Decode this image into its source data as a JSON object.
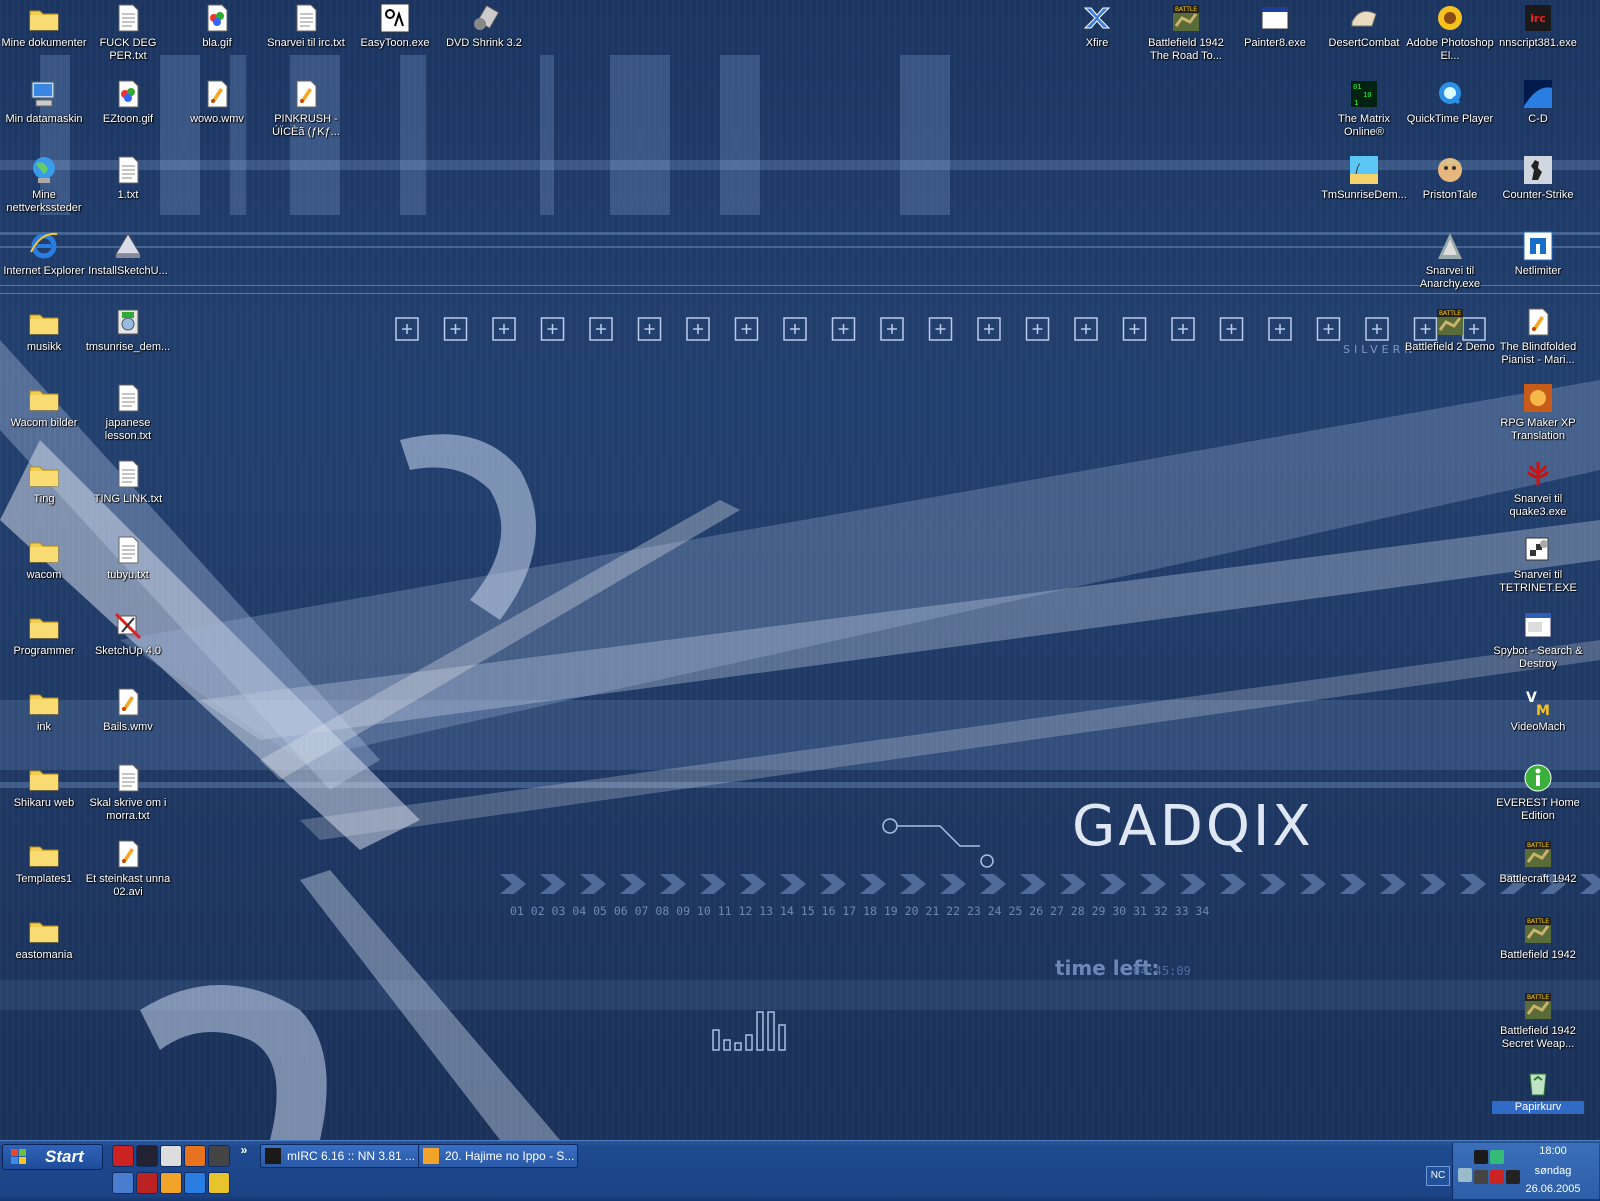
{
  "desktop": {
    "wallpaper": {
      "brand": "GADQIX",
      "timer_label": "time left:",
      "timer_value": "04:45:09",
      "number_row": "01 02 03 04 05 06 07 08 09 10 11 12 13 14 15 16 17 18 19 20 21 22 23 24 25 26 27 28 29 30 31 32 33 34",
      "small_text": "SILVERN",
      "colors": {
        "base": "#1f3a66",
        "accent": "#cfe0ff"
      }
    },
    "icons": [
      {
        "label": "Mine dokumenter",
        "icon": "folder-icon"
      },
      {
        "label": "FUCK DEG PER.txt",
        "icon": "text-file-icon"
      },
      {
        "label": "bla.gif",
        "icon": "image-file-icon"
      },
      {
        "label": "Snarvei til irc.txt",
        "icon": "text-file-icon"
      },
      {
        "label": "EasyToon.exe",
        "icon": "easytoon-icon"
      },
      {
        "label": "DVD Shrink 3.2",
        "icon": "dvd-shrink-icon"
      },
      {
        "label": "Xfire",
        "icon": "xfire-icon"
      },
      {
        "label": "Battlefield 1942 The Road To...",
        "icon": "battlefield-icon"
      },
      {
        "label": "Painter8.exe",
        "icon": "window-app-icon"
      },
      {
        "label": "DesertCombat",
        "icon": "desertcombat-icon"
      },
      {
        "label": "Adobe Photoshop El...",
        "icon": "photoshop-sunflower-icon"
      },
      {
        "label": "nnscript381.exe",
        "icon": "mirc-icon"
      },
      {
        "label": "Min datamaskin",
        "icon": "computer-icon"
      },
      {
        "label": "EZtoon.gif",
        "icon": "image-file-icon"
      },
      {
        "label": "wowo.wmv",
        "icon": "media-file-icon"
      },
      {
        "label": "PINKRUSH - ÚÏCÈã (ƒKƒ...",
        "icon": "media-file-icon"
      },
      {
        "label": "The Matrix Online®",
        "icon": "matrix-icon"
      },
      {
        "label": "QuickTime Player",
        "icon": "quicktime-icon"
      },
      {
        "label": "C-D",
        "icon": "cd-icon"
      },
      {
        "label": "Mine nettverkssteder",
        "icon": "network-globe-icon"
      },
      {
        "label": "1.txt",
        "icon": "text-file-icon"
      },
      {
        "label": "TmSunriseDem...",
        "icon": "tmsunrise-icon"
      },
      {
        "label": "PristonTale",
        "icon": "pristontale-icon"
      },
      {
        "label": "Counter-Strike",
        "icon": "counterstrike-icon"
      },
      {
        "label": "Internet Explorer",
        "icon": "ie-icon"
      },
      {
        "label": "InstallSketchU...",
        "icon": "installer-icon"
      },
      {
        "label": "Snarvei til Anarchy.exe",
        "icon": "anarchy-icon"
      },
      {
        "label": "Netlimiter",
        "icon": "netlimiter-icon"
      },
      {
        "label": "musikk",
        "icon": "folder-icon"
      },
      {
        "label": "tmsunrise_dem...",
        "icon": "installer-cd-icon"
      },
      {
        "label": "Battlefield 2 Demo",
        "icon": "battlefield-icon"
      },
      {
        "label": "The Blindfolded Pianist - Mari...",
        "icon": "media-file-icon"
      },
      {
        "label": "Wacom bilder",
        "icon": "folder-icon"
      },
      {
        "label": "japanese lesson.txt",
        "icon": "text-file-icon"
      },
      {
        "label": "RPG Maker XP Translation",
        "icon": "rpgmaker-icon"
      },
      {
        "label": "Ting",
        "icon": "folder-icon"
      },
      {
        "label": "TING LINK.txt",
        "icon": "text-file-icon"
      },
      {
        "label": "Snarvei til quake3.exe",
        "icon": "quake-icon"
      },
      {
        "label": "wacom",
        "icon": "folder-icon"
      },
      {
        "label": "tubyu.txt",
        "icon": "text-file-icon"
      },
      {
        "label": "Snarvei til TETRINET.EXE",
        "icon": "tetrinet-icon"
      },
      {
        "label": "Programmer",
        "icon": "folder-icon"
      },
      {
        "label": "SketchUp 4.0",
        "icon": "sketchup-icon"
      },
      {
        "label": "Spybot - Search & Destroy",
        "icon": "spybot-icon"
      },
      {
        "label": "ink",
        "icon": "folder-icon"
      },
      {
        "label": "Bails.wmv",
        "icon": "media-file-icon"
      },
      {
        "label": "VideoMach",
        "icon": "videomach-icon"
      },
      {
        "label": "Shikaru web",
        "icon": "folder-icon"
      },
      {
        "label": "Skal skrive om i morra.txt",
        "icon": "text-file-icon"
      },
      {
        "label": "EVEREST Home Edition",
        "icon": "everest-icon"
      },
      {
        "label": "Templates1",
        "icon": "folder-icon"
      },
      {
        "label": "Et steinkast unna 02.avi",
        "icon": "media-file-icon"
      },
      {
        "label": "Battlecraft 1942",
        "icon": "battlefield-icon"
      },
      {
        "label": "eastomania",
        "icon": "folder-icon"
      },
      {
        "label": "Battlefield 1942",
        "icon": "battlefield-icon"
      },
      {
        "label": "Battlefield 1942 Secret Weap...",
        "icon": "battlefield-icon"
      },
      {
        "label": "Papirkurv",
        "icon": "recycle-bin-icon"
      }
    ]
  },
  "taskbar": {
    "start_label": "Start",
    "quicklaunch": [
      "opera-icon",
      "mirc-icon",
      "media-icon",
      "firefox-icon",
      "steam-icon",
      "desktop-icon",
      "red-icon",
      "winamp-icon",
      "ie-icon",
      "globe-icon"
    ],
    "tasks": [
      {
        "label": "mIRC 6.16 :: NN 3.81 ...",
        "icon": "mirc-icon"
      },
      {
        "label": "20. Hajime no Ippo - S...",
        "icon": "winamp-icon"
      }
    ],
    "tray": {
      "nc_label": "NC",
      "icons": [
        "net-icon",
        "mirc-icon",
        "messenger-icon",
        "steam-icon",
        "shield-icon",
        "ati-icon"
      ],
      "time": "18:00",
      "day": "søndag",
      "date": "26.06.2005"
    }
  }
}
